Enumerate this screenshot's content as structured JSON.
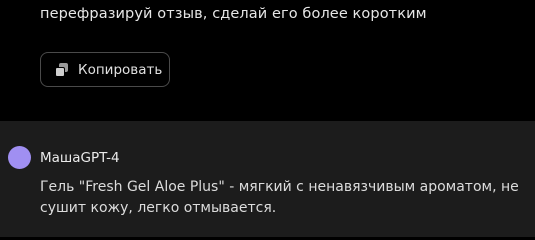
{
  "user_message": {
    "text": "перефразируй отзыв, сделай его более коротким",
    "copy_button": {
      "label": "Копировать",
      "icon": "copy-icon"
    }
  },
  "bot_message": {
    "avatar_color": "#a08ff2",
    "name": "МашаGPT-4",
    "text": "Гель \"Fresh Gel Aloe Plus\" - мягкий с ненавязчивым ароматом, не сушит кожу, легко отмывается."
  }
}
